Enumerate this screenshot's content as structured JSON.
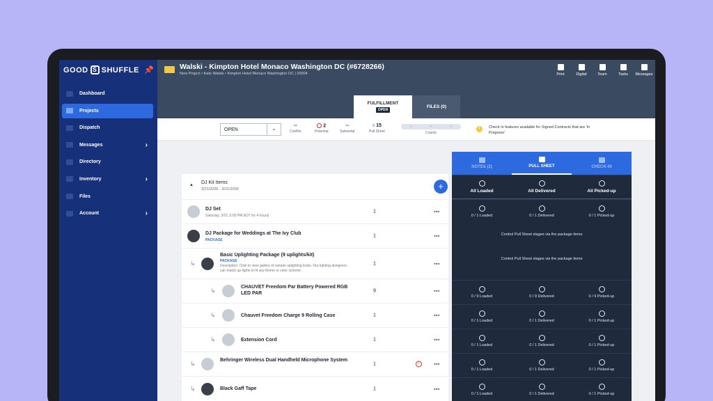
{
  "app": {
    "brand": "GOOD",
    "brand_mark": "S",
    "brand_suffix": "SHUFFLE"
  },
  "sidebar": {
    "items": [
      {
        "label": "Dashboard"
      },
      {
        "label": "Projects"
      },
      {
        "label": "Dispatch"
      },
      {
        "label": "Messages",
        "chevron": "›"
      },
      {
        "label": "Directory"
      },
      {
        "label": "Inventory",
        "chevron": "›"
      },
      {
        "label": "Files"
      },
      {
        "label": "Account",
        "chevron": "›"
      }
    ]
  },
  "header": {
    "title": "Walski - Kimpton Hotel Monaco Washington DC (#6728266)",
    "subtitle": "New Project • Kate Walski • Kimpton Hotel Monaco Washington DC | 20004",
    "actions": [
      "Print",
      "Digital",
      "Team",
      "Tasks",
      "Messages"
    ],
    "tabs": {
      "fulfillment": "FULFILLMENT",
      "fulfillment_badge": "OPEN",
      "files": "FILES (0)"
    }
  },
  "toolbar": {
    "status": "OPEN",
    "caret": "⌄",
    "conflict": {
      "value": "--",
      "label": "Conflict"
    },
    "potential": {
      "value": "2",
      "label": "Potential"
    },
    "subrental": {
      "value": "--",
      "label": "Subrental"
    },
    "pull_sheet": {
      "value": "15",
      "label": "Pull Sheet"
    },
    "counts": {
      "a": "--",
      "b": "--",
      "c": "--",
      "label": "Counts"
    },
    "info": "Check In features available for Signed Contracts that are 'In Progress'"
  },
  "kit": {
    "title": "DJ Kit Items",
    "dates": "3/21/2026 - 3/21/2026",
    "add": "+",
    "caret": "▲",
    "rows": [
      {
        "name": "DJ Set",
        "sub": "Saturday, 3/21  |1:00 PM EDT for 4 hours|",
        "qty": "1"
      },
      {
        "name": "DJ Package for Weddings at The Ivy Club",
        "tag": "PACKAGE",
        "qty": "1"
      },
      {
        "name": "Basic Uplighting Package (9 uplights/kit)",
        "tag": "PACKAGE",
        "sub": "Description: Click to view gallery of sample uplighting looks. Our lighting designers can match up-lights to fit any theme or color scheme.",
        "qty": "1"
      },
      {
        "name": "CHAUVET Freedom Par Battery Powered RGB LED PAR",
        "qty": "9"
      },
      {
        "name": "Chauvet Freedom Charge 9 Rolling Case",
        "qty": "1"
      },
      {
        "name": "Extension Cord",
        "qty": "1"
      },
      {
        "name": "Behringer Wireless Dual Handheld Microphone System",
        "qty": "1",
        "alert": "!"
      },
      {
        "name": "Black Gaff Tape",
        "qty": "1"
      }
    ]
  },
  "pull_sheet": {
    "tabs": [
      "NOTES (2)",
      "PULL SHEET",
      "CHECK-IN"
    ],
    "all": [
      "All Loaded",
      "All Delivered",
      "All Picked-up"
    ],
    "note": "Control Pull Sheet stages via the package items",
    "rows": [
      [
        "0 / 1 Loaded",
        "0 / 1 Delivered",
        "0 / 1 Picked-up"
      ],
      [
        "0 / 9 Loaded",
        "0 / 9 Delivered",
        "0 / 9 Picked-up"
      ],
      [
        "0 / 1 Loaded",
        "0 / 1 Delivered",
        "0 / 1 Picked-up"
      ],
      [
        "0 / 1 Loaded",
        "0 / 1 Delivered",
        "0 / 1 Picked-up"
      ],
      [
        "0 / 1 Loaded",
        "0 / 1 Delivered",
        "0 / 1 Picked-up"
      ],
      [
        "0 / 1 Loaded",
        "0 / 1 Delivered",
        "0 / 1 Picked-up"
      ]
    ]
  },
  "colors": {
    "sidebar": "#17307a",
    "accent": "#2d6ae0",
    "header": "#3a4a60",
    "panel": "#1f2b3d",
    "background": "#b7b5f7"
  }
}
